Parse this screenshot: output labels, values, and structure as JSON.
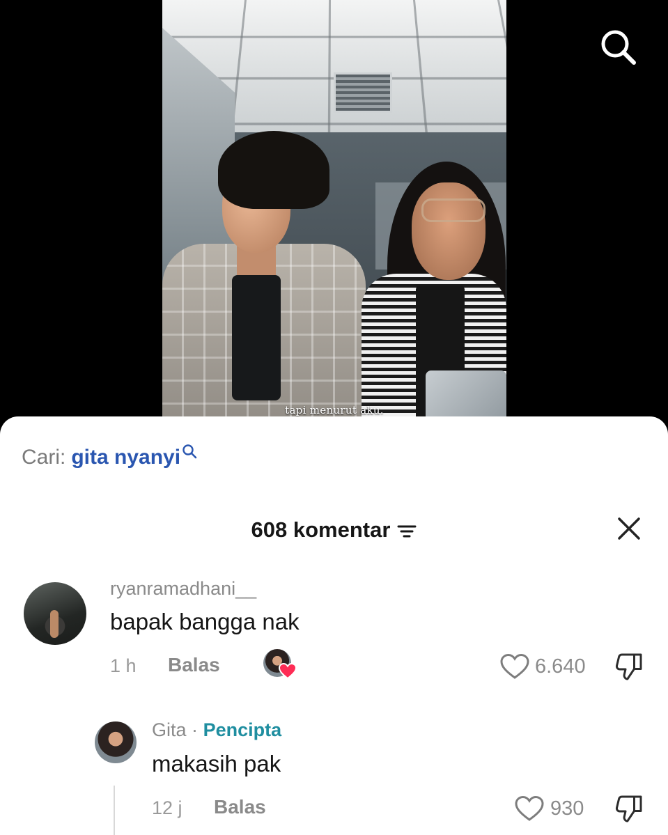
{
  "video": {
    "caption": "tapi menurut aku."
  },
  "top_bar": {
    "search_icon": "search-icon"
  },
  "search_suggestion": {
    "prefix": "Cari:",
    "query": "gita nyanyi",
    "icon": "search-icon"
  },
  "comments_header": {
    "title": "608 komentar",
    "sort_icon": "sort-icon",
    "close_icon": "close-icon"
  },
  "comments": [
    {
      "username": "ryanramadhani__",
      "text": "bapak bangga nak",
      "time": "1 h",
      "reply_label": "Balas",
      "likes": "6.640",
      "liked_by_creator": true
    }
  ],
  "replies": [
    {
      "username": "Gita",
      "separator": "·",
      "badge": "Pencipta",
      "text": "makasih pak",
      "time": "12 j",
      "reply_label": "Balas",
      "likes": "930"
    }
  ],
  "colors": {
    "link_blue": "#2a56b0",
    "creator_teal": "#1f8ea0",
    "heart_red": "#fe2c55",
    "muted_text": "#8a8a8a"
  }
}
